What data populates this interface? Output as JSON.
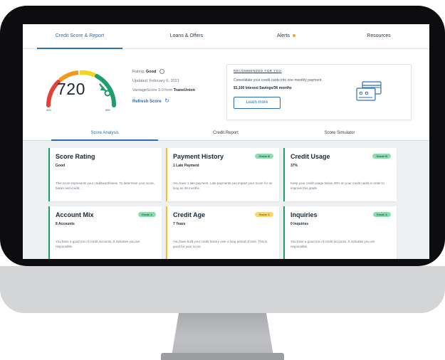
{
  "nav": {
    "tabs": [
      {
        "label": "Credit Score & Report"
      },
      {
        "label": "Loans & Offers"
      },
      {
        "label": "Alerts"
      },
      {
        "label": "Resources"
      }
    ]
  },
  "score": {
    "value": "720",
    "gauge_min": "300",
    "gauge_max": "850",
    "rating_label": "Rating:",
    "rating_value": "Good",
    "updated": "Updated: February 6, 2021",
    "source_prefix": "VantageScore 3.0 from",
    "source_provider": "TransUnion",
    "refresh_label": "Refresh Score"
  },
  "promo": {
    "tag": "RECOMMENDED FOR YOU",
    "text": "Consolidate your credit cards into one monthly payment.",
    "bold_text": "$1,100 Interest Savings/36 months",
    "button_label": "Learn more"
  },
  "subtabs": [
    {
      "label": "Score Analysis"
    },
    {
      "label": "Credit Report"
    },
    {
      "label": "Score Simulator"
    }
  ],
  "cards": [
    {
      "title": "Score Rating",
      "subtitle": "Good",
      "badge": "",
      "description": "This score represents your creditworthiness. To determine your score, banks and credit..."
    },
    {
      "title": "Payment History",
      "subtitle": "1 Late Payment",
      "badge": "Grade B",
      "description": "You have 1 late payment. Late payments can impact your score for as long as 48 months."
    },
    {
      "title": "Credit Usage",
      "subtitle": "37%",
      "badge": "Grade B",
      "description": "Keep your credit usage below 30% on your credit cards in order to improve this grade."
    },
    {
      "title": "Account Mix",
      "subtitle": "8 Accounts",
      "badge": "Grade A",
      "description": "You have a good mix of credit accounts. It indicates you are responsible."
    },
    {
      "title": "Credit Age",
      "subtitle": "7 Years",
      "badge": "Grade C",
      "description": "You have built your credit history over a long period of time. This is good for your score."
    },
    {
      "title": "Inquiries",
      "subtitle": "0 Inquiries",
      "badge": "Grade A",
      "description": "You have a good mix of credit accounts. It indicates you are responsible."
    }
  ],
  "colors": {
    "accent": "#2a6fb5",
    "grade_green": "#1f9e6b",
    "grade_yellow": "#f2c420",
    "alert_dot": "#f4a020"
  }
}
